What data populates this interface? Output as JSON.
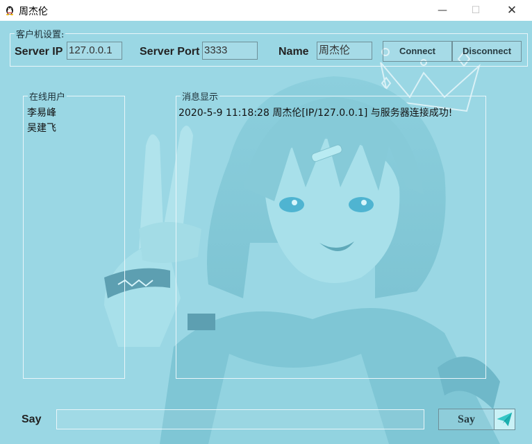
{
  "window": {
    "title": "周杰伦",
    "icon": "qq-penguin-icon",
    "controls": {
      "minimize": "—",
      "maximize": "☐",
      "close": "✕"
    }
  },
  "client_settings": {
    "legend": "客户机设置:",
    "server_ip_label": "Server IP",
    "server_ip_value": "127.0.0.1",
    "server_port_label": "Server Port",
    "server_port_value": "3333",
    "name_label": "Name",
    "name_value": "周杰伦",
    "connect_label": "Connect",
    "disconnect_label": "Disconnect"
  },
  "online_users": {
    "legend": "在线用户",
    "items": [
      "李易峰",
      "吴建飞"
    ]
  },
  "messages": {
    "legend": "消息显示",
    "items": [
      "2020-5-9 11:18:28 周杰伦[IP/127.0.0.1] 与服务器连接成功!"
    ]
  },
  "say": {
    "label": "Say",
    "input_value": "",
    "button_label": "Say",
    "send_icon": "paper-plane-icon"
  },
  "colors": {
    "background": "#9ad7e4",
    "border_light": "#e9f6fa",
    "border_dark": "#6e8f98"
  }
}
